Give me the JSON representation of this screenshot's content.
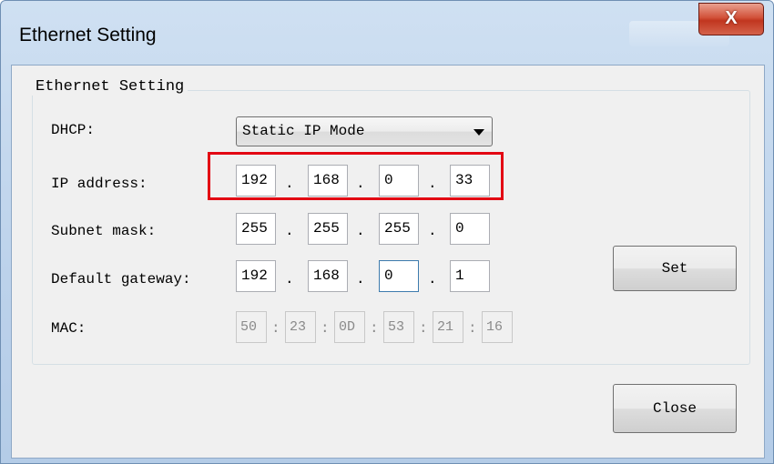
{
  "window": {
    "title": "Ethernet Setting",
    "close_glyph": "X"
  },
  "group": {
    "title": "Ethernet Setting"
  },
  "dhcp": {
    "label": "DHCP:",
    "selected": "Static IP Mode",
    "icon": "chevron-down-icon"
  },
  "ip": {
    "label": "IP address:",
    "octets": [
      "192",
      "168",
      "0",
      "33"
    ],
    "separator": "."
  },
  "subnet": {
    "label": "Subnet mask:",
    "octets": [
      "255",
      "255",
      "255",
      "0"
    ],
    "separator": "."
  },
  "gateway": {
    "label": "Default gateway:",
    "octets": [
      "192",
      "168",
      "0",
      "1"
    ],
    "separator": "."
  },
  "mac": {
    "label": "MAC:",
    "bytes": [
      "50",
      "23",
      "0D",
      "53",
      "21",
      "16"
    ],
    "separator": ":"
  },
  "buttons": {
    "set": "Set",
    "close": "Close"
  },
  "colors": {
    "highlight": "#e30613",
    "titlebar": "#bcd2eb",
    "dialog": "#f0f0f0"
  }
}
